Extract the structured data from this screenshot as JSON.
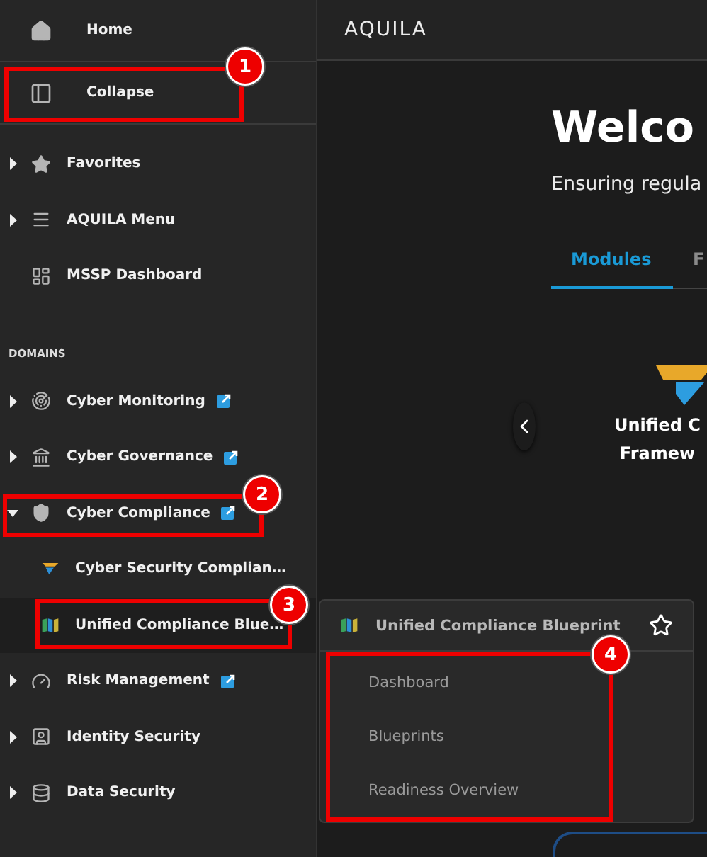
{
  "sidebar": {
    "top_items": [
      {
        "label": "Home",
        "kind": "home"
      },
      {
        "label": "Collapse",
        "kind": "panel"
      }
    ],
    "items": [
      {
        "label": "Favorites",
        "kind": "star",
        "expanded": false
      },
      {
        "label": "AQUILA Menu",
        "kind": "menu",
        "expanded": false
      },
      {
        "label": "MSSP Dashboard",
        "kind": "dashboard"
      }
    ],
    "section_title": "DOMAINS",
    "domains": [
      {
        "label": "Cyber Monitoring",
        "kind": "radar",
        "expanded": false,
        "external_link": true
      },
      {
        "label": "Cyber Governance",
        "kind": "landmark",
        "expanded": false,
        "external_link": true
      },
      {
        "label": "Cyber Compliance",
        "kind": "shield",
        "expanded": true,
        "external_link": true,
        "children": [
          {
            "label": "Cyber Security Complian…",
            "kind": "funnel",
            "selected": false
          },
          {
            "label": "Unified Compliance Blue…",
            "kind": "map",
            "selected": true
          }
        ]
      },
      {
        "label": "Risk Management",
        "kind": "gauge",
        "expanded": false,
        "external_link": true
      },
      {
        "label": "Identity Security",
        "kind": "badge",
        "expanded": false,
        "external_link": false
      },
      {
        "label": "Data Security",
        "kind": "database",
        "expanded": false,
        "external_link": false
      }
    ]
  },
  "header": {
    "logo": "AQUILA"
  },
  "main": {
    "title": "Welco",
    "subtitle": "Ensuring regula",
    "tabs": [
      {
        "label": "Modules",
        "selected": true
      },
      {
        "label": "F",
        "selected": false
      }
    ],
    "card_title_lines": [
      "Unified C",
      "Framew"
    ]
  },
  "flyout": {
    "title": "Unified Compliance Blueprint",
    "favorite": false,
    "items": [
      "Dashboard",
      "Blueprints",
      "Readiness Overview"
    ]
  },
  "annotations": [
    {
      "number": "1"
    },
    {
      "number": "2"
    },
    {
      "number": "3"
    },
    {
      "number": "4"
    }
  ]
}
